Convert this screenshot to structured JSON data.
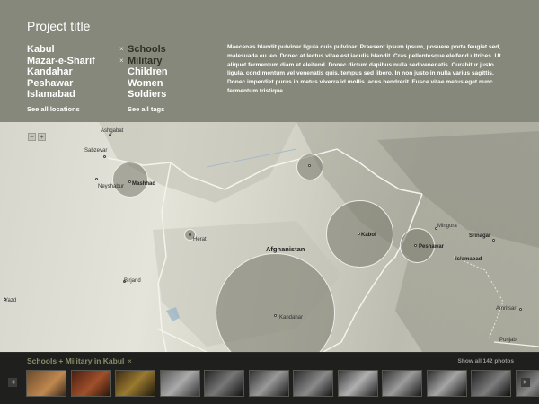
{
  "header": {
    "title": "Project title",
    "locations": [
      "Kabul",
      "Mazar-e-Sharif",
      "Kandahar",
      "Peshawar",
      "Islamabad"
    ],
    "see_all_locations": "See all locations",
    "tags": [
      {
        "label": "Schools",
        "selected": true
      },
      {
        "label": "Military",
        "selected": true
      },
      {
        "label": "Children",
        "selected": false
      },
      {
        "label": "Women",
        "selected": false
      },
      {
        "label": "Soldiers",
        "selected": false
      }
    ],
    "see_all_tags": "See all tags",
    "remove_glyph": "×",
    "description": "Maecenas blandit pulvinar ligula quis pulvinar. Praesent ipsum ipsum, posuere porta feugiat sed, malesuada eu leo. Donec at lectus vitae est iaculis blandit. Cras pellentesque eleifend ultrices. Ut aliquet fermentum diam et eleifend. Donec dictum dapibus nulla sed venenatis. Curabitur justo ligula, condimentum vel venenatis quis, tempus sed libero. In non justo in nulla varius sagittis. Donec imperdiet purus in metus viverra id mollis lacus hendrerit. Fusce vitae metus eget nunc fermentum tristique."
  },
  "map": {
    "zoom_out": "−",
    "zoom_in": "+",
    "cities": {
      "ashgabat": "Ashgabat",
      "sabzevar": "Sabzevar",
      "neyshabur": "Neyshabur",
      "mashhad": "Mashhad",
      "herat": "Herat",
      "birjand": "Birjand",
      "yazd": "Yazd",
      "afghanistan": "Afghanistan",
      "kandahar": "Kandahar",
      "kabol": "Kabol",
      "peshawar": "Peshawar",
      "mingora": "Mingora",
      "srinagar": "Srinagar",
      "islamabad": "Islamabad",
      "amritsar": "Amritsar",
      "punjab": "Punjab"
    }
  },
  "gallery": {
    "title": "Schools + Military in Kabul",
    "close_glyph": "×",
    "show_all": "Show all 142 photos",
    "prev_glyph": "◀",
    "next_glyph": "▶",
    "thumb_count": 12
  }
}
